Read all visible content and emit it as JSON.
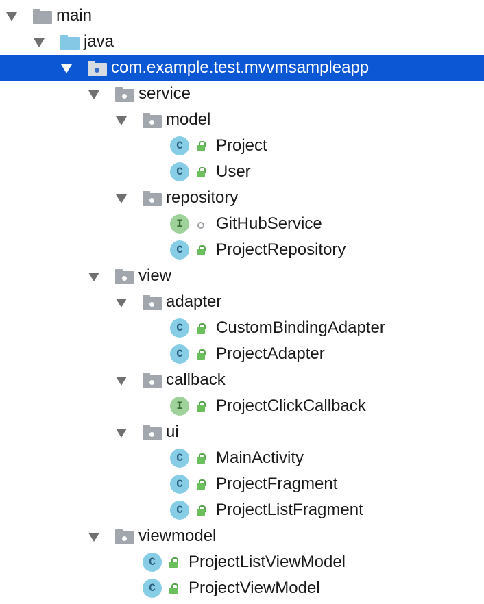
{
  "tree": {
    "main": "main",
    "java": "java",
    "package": "com.example.test.mvvmsampleapp",
    "service": "service",
    "model": "model",
    "project": "Project",
    "user": "User",
    "repository": "repository",
    "github_service": "GitHubService",
    "project_repository": "ProjectRepository",
    "view": "view",
    "adapter": "adapter",
    "custom_binding_adapter": "CustomBindingAdapter",
    "project_adapter": "ProjectAdapter",
    "callback": "callback",
    "project_click_callback": "ProjectClickCallback",
    "ui": "ui",
    "main_activity": "MainActivity",
    "project_fragment": "ProjectFragment",
    "project_list_fragment": "ProjectListFragment",
    "viewmodel": "viewmodel",
    "project_list_view_model": "ProjectListViewModel",
    "project_view_model": "ProjectViewModel"
  },
  "badges": {
    "class": "C",
    "interface": "I"
  },
  "icons": {
    "folder": "folder-icon",
    "source_folder": "source-folder-icon",
    "package": "package-icon",
    "class": "class-icon",
    "interface": "interface-icon",
    "public": "lock-icon",
    "package_private": "circle-icon"
  },
  "colors": {
    "selection": "#0c57d3",
    "class_badge": "#88cde6",
    "interface_badge": "#9fd29a",
    "folder_gray": "#a2a7ad",
    "folder_blue": "#84c8e6"
  }
}
